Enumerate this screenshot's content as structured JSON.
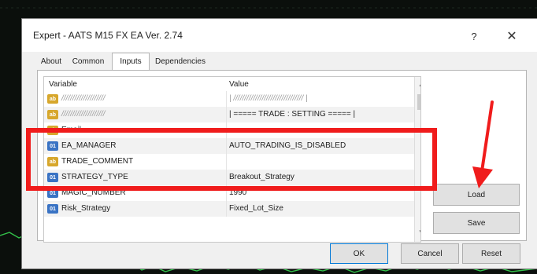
{
  "window": {
    "title": "Expert - AATS M15 FX EA Ver. 2.74",
    "help_label": "?",
    "close_label": "✕"
  },
  "tabs": [
    {
      "label": "About"
    },
    {
      "label": "Common"
    },
    {
      "label": "Inputs",
      "active": true
    },
    {
      "label": "Dependencies"
    }
  ],
  "table": {
    "headers": {
      "variable": "Variable",
      "value": "Value"
    },
    "rows": [
      {
        "icon": "ab",
        "variable": "////////////////////",
        "value": "| //////////////////////////////// |"
      },
      {
        "icon": "ab",
        "variable": "////////////////////",
        "value": "| ===== TRADE : SETTING ===== |"
      },
      {
        "icon": "ab",
        "variable": "Email",
        "value": ""
      },
      {
        "icon": "num",
        "variable": "EA_MANAGER",
        "value": "AUTO_TRADING_IS_DISABLED"
      },
      {
        "icon": "ab",
        "variable": "TRADE_COMMENT",
        "value": ""
      },
      {
        "icon": "num",
        "variable": "STRATEGY_TYPE",
        "value": "Breakout_Strategy"
      },
      {
        "icon": "num",
        "variable": "MAGIC_NUMBER",
        "value": "1990"
      },
      {
        "icon": "num",
        "variable": "Risk_Strategy",
        "value": "Fixed_Lot_Size"
      }
    ]
  },
  "buttons": {
    "load": "Load",
    "save": "Save",
    "ok": "OK",
    "cancel": "Cancel",
    "reset": "Reset"
  },
  "colors": {
    "highlight": "#f01c1c",
    "chart_bg": "#0b0f0c"
  }
}
